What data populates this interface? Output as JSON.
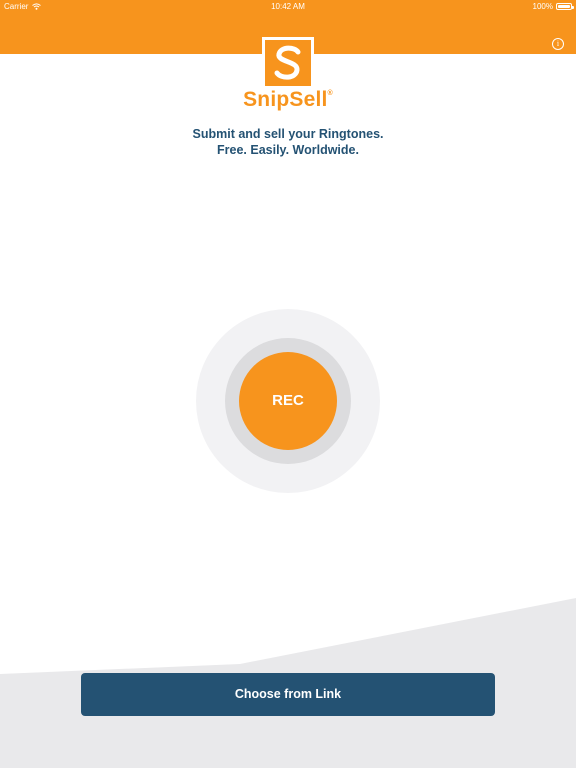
{
  "status_bar": {
    "carrier": "Carrier",
    "time": "10:42 AM",
    "battery": "100%"
  },
  "header": {
    "info_icon": "info-icon",
    "info_glyph": "i"
  },
  "logo": {
    "glyph": "S",
    "name": "SnipSell",
    "trademark": "®"
  },
  "tagline": {
    "line1": "Submit and sell your Ringtones.",
    "line2": "Free. Easily. Worldwide."
  },
  "record": {
    "label": "REC"
  },
  "actions": {
    "choose_link_label": "Choose from Link"
  },
  "colors": {
    "brand_orange": "#f7941d",
    "brand_blue": "#245273",
    "bottom_grey": "#e9e9eb"
  }
}
